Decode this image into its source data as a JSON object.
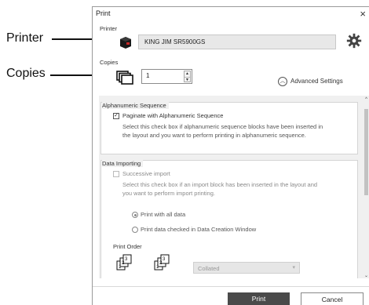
{
  "callouts": {
    "printer": "Printer",
    "copies": "Copies"
  },
  "window": {
    "title": "Print",
    "close_glyph": "×"
  },
  "printer": {
    "section_label": "Printer",
    "name": "KING JIM SR5900GS",
    "icon": "printer-icon",
    "settings_icon": "gear-icon"
  },
  "copies": {
    "section_label": "Copies",
    "value": "1",
    "icon": "copies-icon"
  },
  "advanced": {
    "label": "Advanced Settings",
    "icon": "chevron-up-circle-icon"
  },
  "alphanumeric": {
    "title": "Alphanumeric Sequence",
    "checkbox_label": "Paginate with Alphanumeric Sequence",
    "checked": true,
    "description_line1": "Select this check box if alphanumeric sequence blocks have been inserted in",
    "description_line2": "the layout and you want to perform printing in alphanumeric sequence."
  },
  "data_importing": {
    "title": "Data Importing",
    "checkbox_label": "Successive import",
    "checked": false,
    "description_line1": "Select this check box if an import block has been inserted in the layout and",
    "description_line2": "you want to perform import printing.",
    "radio_all": "Print with all data",
    "radio_checked": "Print data checked in Data Creation Window",
    "print_order_label": "Print Order",
    "print_order_value": "Collated"
  },
  "footer": {
    "print": "Print",
    "cancel": "Cancel"
  },
  "colors": {
    "primary_button": "#4a4a4a",
    "panel_background": "#f0f0f0"
  }
}
